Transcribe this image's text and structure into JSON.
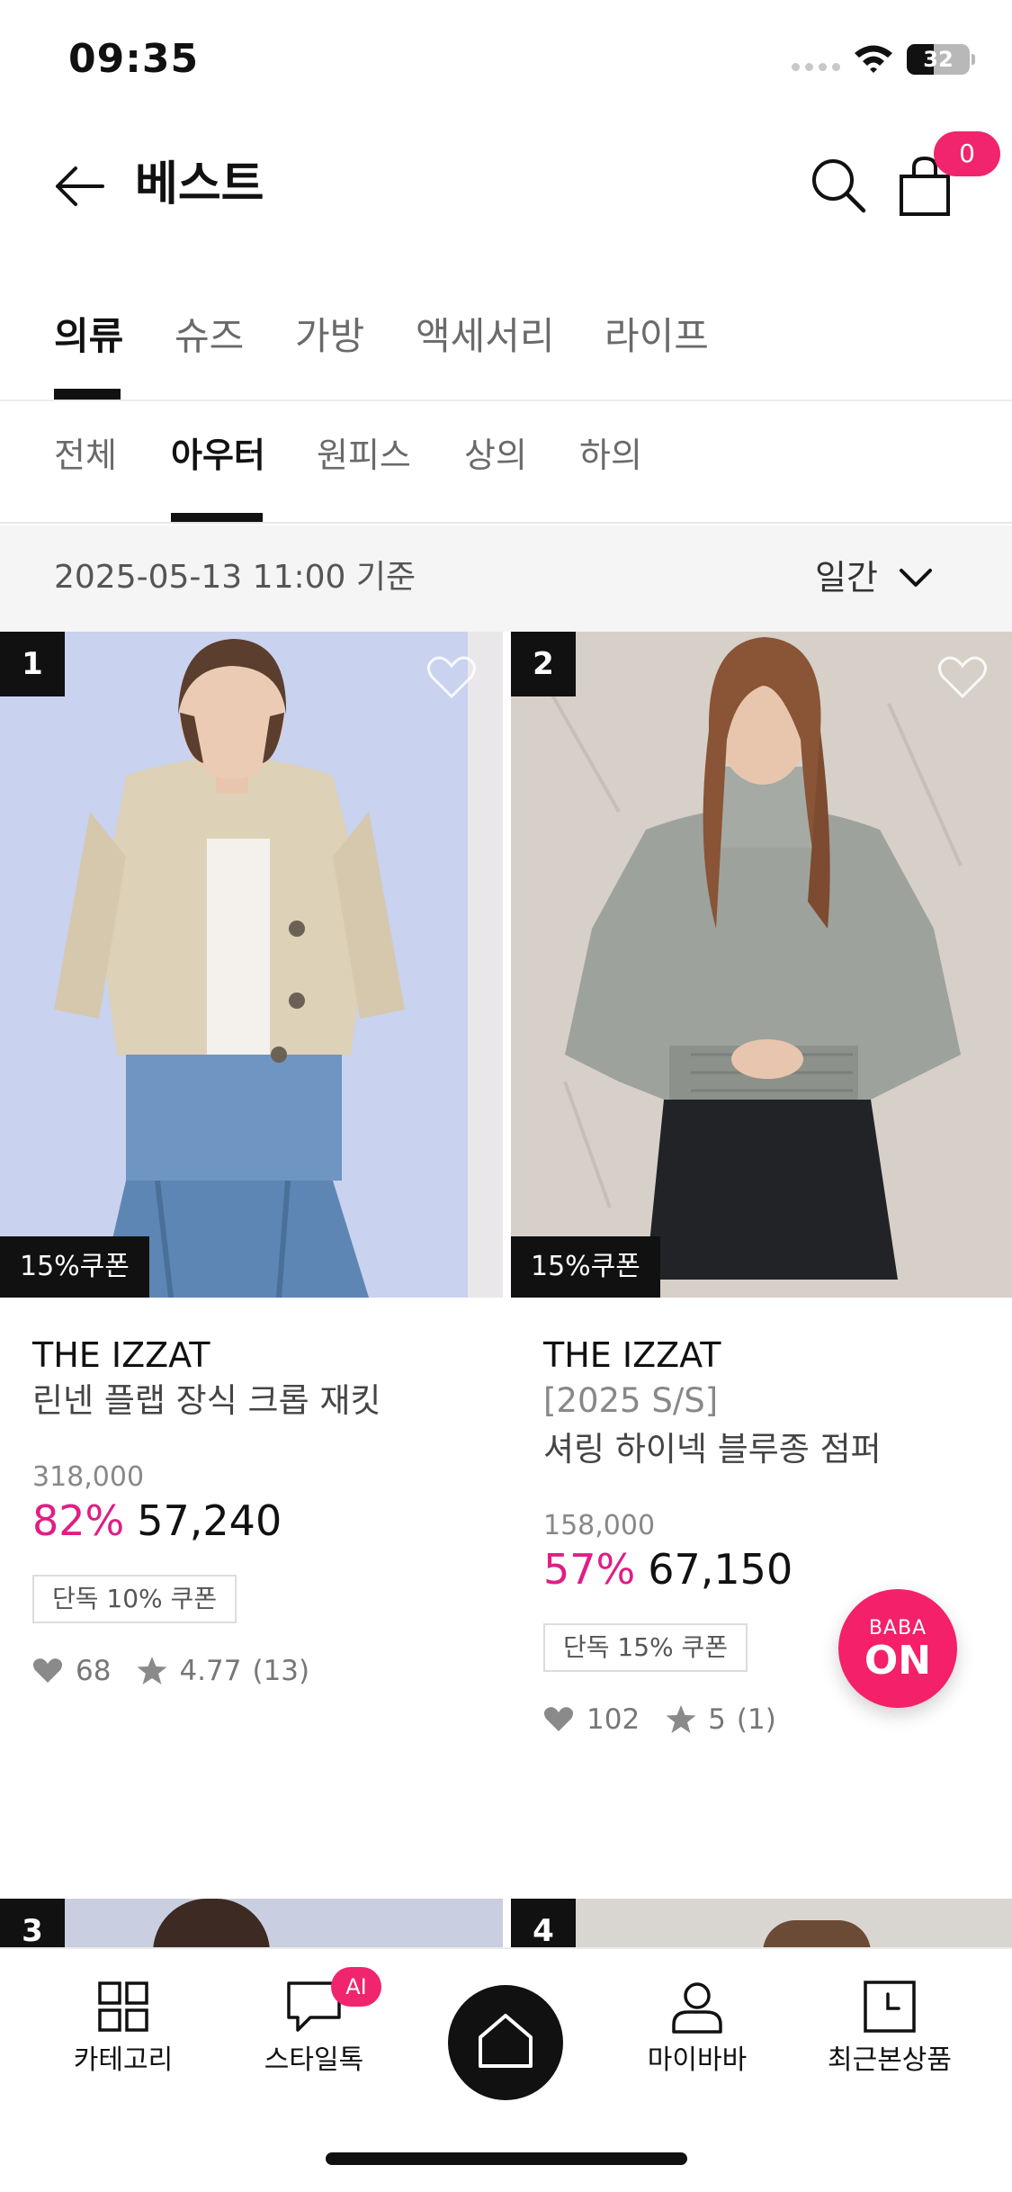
{
  "status_bar": {
    "time": "09:35",
    "battery": "32"
  },
  "header": {
    "title": "베스트",
    "cart_count": "0"
  },
  "main_tabs": [
    {
      "label": "의류",
      "active": true
    },
    {
      "label": "슈즈"
    },
    {
      "label": "가방"
    },
    {
      "label": "액세서리"
    },
    {
      "label": "라이프"
    }
  ],
  "sub_tabs": [
    {
      "label": "전체"
    },
    {
      "label": "아우터",
      "active": true
    },
    {
      "label": "원피스"
    },
    {
      "label": "상의"
    },
    {
      "label": "하의"
    }
  ],
  "date_bar": {
    "date": "2025-05-13 11:00 기준",
    "period": "일간"
  },
  "products": [
    {
      "rank": "1",
      "coupon_tag": "15%쿠폰",
      "brand": "THE IZZAT",
      "name_lines": [
        "린넨 플랩 장식 크롭 재킷"
      ],
      "original_price": "318,000",
      "discount": "82%",
      "price": "57,240",
      "coupon": "단독 10% 쿠폰",
      "likes": "68",
      "rating": "4.77",
      "reviews": "(13)"
    },
    {
      "rank": "2",
      "coupon_tag": "15%쿠폰",
      "brand": "THE IZZAT",
      "name_lines": [
        "[2025 S/S]",
        "셔링 하이넥 블루종 점퍼"
      ],
      "original_price": "158,000",
      "discount": "57%",
      "price": "67,150",
      "coupon": "단독 15% 쿠폰",
      "likes": "102",
      "rating": "5",
      "reviews": "(1)"
    }
  ],
  "next_ranks": [
    "3",
    "4"
  ],
  "floating_button": {
    "top": "BABA",
    "bottom": "ON"
  },
  "bottom_nav": [
    {
      "label": "카테고리",
      "icon": "grid-icon"
    },
    {
      "label": "스타일톡",
      "icon": "chat-icon",
      "badge": "AI"
    },
    {
      "label": "",
      "icon": "home-icon"
    },
    {
      "label": "마이바바",
      "icon": "user-icon"
    },
    {
      "label": "최근본상품",
      "icon": "recent-icon"
    }
  ],
  "colors": {
    "accent": "#f0256d",
    "discount": "#e01e84",
    "text": "#111111"
  }
}
